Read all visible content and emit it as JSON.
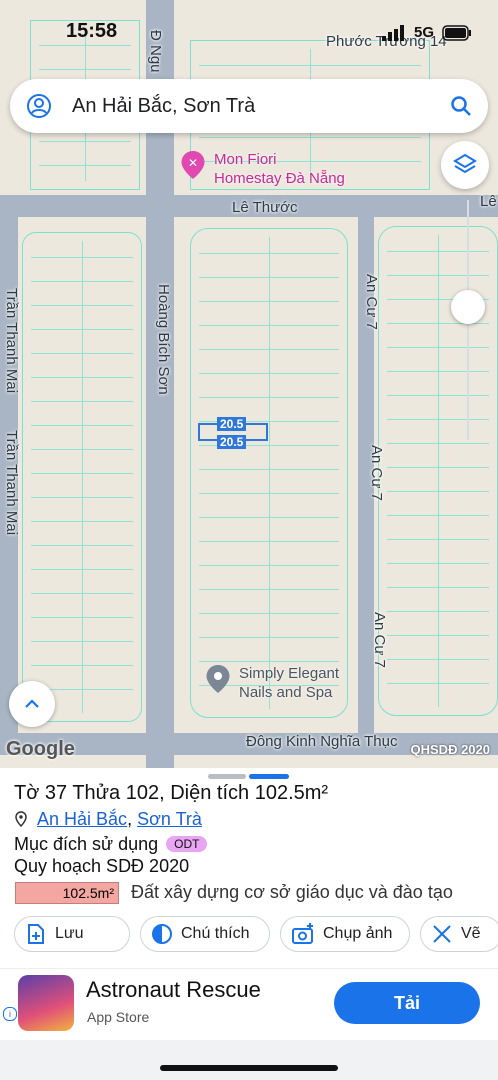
{
  "status_bar": {
    "time": "15:58",
    "network": "5G"
  },
  "search": {
    "text": "An Hải Bắc, Sơn Trà"
  },
  "map": {
    "streets": {
      "top": "Phước Trường 14",
      "nguyen": "Đ Ngu",
      "le_thuoc": "Lê Thước",
      "le_right": "Lê",
      "hoang_bich_son": "Hoàng Bích Sơn",
      "tran_thanh_mai_1": "Trần Thanh Mai",
      "tran_thanh_mai_2": "Trần Thanh Mai",
      "an_cu_1": "An Cư 7",
      "an_cu_2": "An Cư 7",
      "an_cu_3": "An Cư 7",
      "dong_kinh": "Đông Kinh Nghĩa Thục"
    },
    "pois": [
      {
        "line1": "Mon Fiori",
        "line2": "Homestay Đà Nẵng"
      },
      {
        "line1": "Simply Elegant",
        "line2": "Nails and Spa"
      }
    ],
    "measurements": [
      "20.5",
      "20.5"
    ],
    "google": "Google",
    "overlay_label": "QHSDĐ 2020"
  },
  "sheet": {
    "title": "Tờ 37 Thửa 102, Diện tích 102.5m²",
    "ward": "An Hải Bắc",
    "district": "Sơn Trà",
    "purpose_label": "Mục đích sử dụng",
    "purpose_code": "ODT",
    "plan_label": "Quy hoạch SDĐ 2020",
    "plan_area": "102.5m²",
    "plan_desc": "Đất xây dựng cơ sở giáo dục và đào tạo",
    "actions": [
      "Lưu",
      "Chú thích",
      "Chụp ảnh",
      "Vẽ"
    ]
  },
  "ad": {
    "title": "Astronaut Rescue",
    "store": "App Store",
    "button": "Tải",
    "info": "i"
  }
}
